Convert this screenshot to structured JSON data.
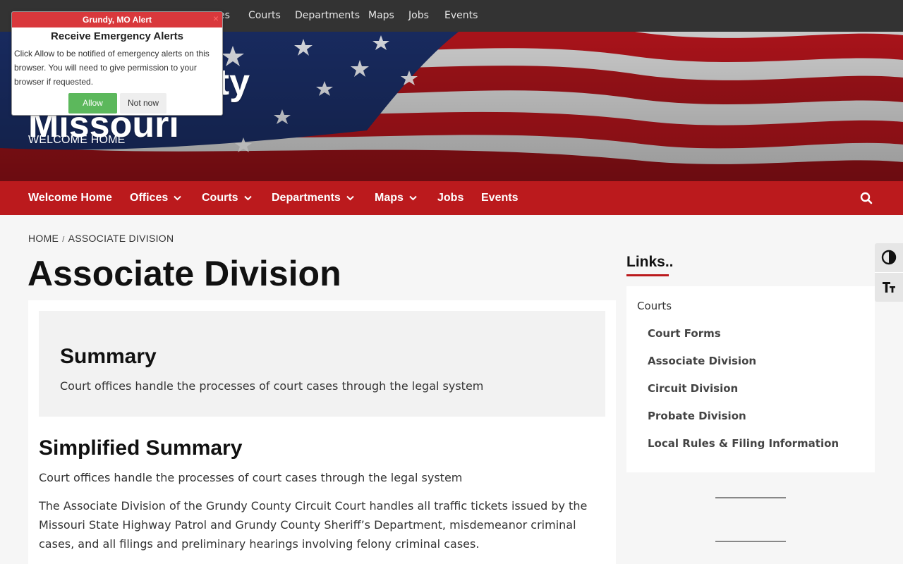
{
  "topbar": {
    "items": [
      "es",
      "Courts",
      "Departments",
      "Maps",
      "Jobs",
      "Events"
    ]
  },
  "hero": {
    "title_line1": "nty",
    "title_line2": "Missouri",
    "tagline": "WELCOME HOME"
  },
  "mainnav": {
    "items": [
      {
        "label": "Welcome Home"
      },
      {
        "label": "Offices"
      },
      {
        "label": "Courts"
      },
      {
        "label": "Departments"
      },
      {
        "label": "Maps"
      },
      {
        "label": "Jobs"
      },
      {
        "label": "Events"
      }
    ]
  },
  "breadcrumb": {
    "home": "HOME",
    "separator": "/",
    "current": "ASSOCIATE DIVISION"
  },
  "page": {
    "title": "Associate Division",
    "summary_heading": "Summary",
    "summary_text": "Court offices handle the processes of court cases through the legal system",
    "simplified_heading": "Simplified Summary",
    "simplified_text": "Court offices handle the processes of court cases through the legal system",
    "body_text": "The Associate Division of the Grundy County Circuit Court handles all traffic tickets issued by the Missouri State Highway Patrol and Grundy County Sheriff’s Department, misdemeanor criminal cases, and all filings and preliminary hearings involving felony criminal cases."
  },
  "sidebar": {
    "title": "Links..",
    "links": [
      {
        "label": "Courts"
      },
      {
        "label": "Court Forms"
      },
      {
        "label": "Associate Division"
      },
      {
        "label": "Circuit Division"
      },
      {
        "label": "Probate Division"
      },
      {
        "label": "Local Rules & Filing Information"
      }
    ]
  },
  "alert": {
    "header": "Grundy, MO Alert",
    "heading": "Receive Emergency Alerts",
    "message": "Click Allow to be notified of emergency alerts on this browser. You will need to give permission to your browser if requested.",
    "allow_label": "Allow",
    "notnow_label": "Not now",
    "close_glyph": "×"
  },
  "a11y": {
    "icons": [
      "contrast-icon",
      "text-size-icon"
    ]
  },
  "colors": {
    "topbar": "#333333",
    "nav_red": "#bb1a1d",
    "alert_red": "#d9383c",
    "allow_green": "#5cb85c"
  }
}
